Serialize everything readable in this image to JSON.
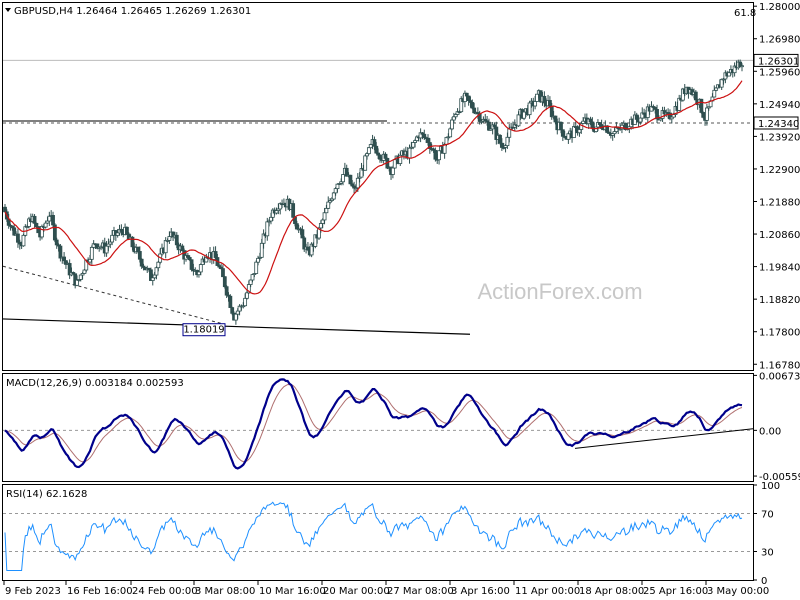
{
  "chart_data": [
    {
      "type": "candlestick",
      "panel": "price",
      "symbol_header": "GBPUSD,H4  1.26464 1.26465 1.26269 1.26301",
      "watermark": "ActionForex.com",
      "ylim": [
        1.166,
        1.281
      ],
      "y_ticks": [
        "1.28000",
        "1.26980",
        "1.25960",
        "1.24940",
        "1.23920",
        "1.22900",
        "1.21880",
        "1.20860",
        "1.19840",
        "1.18820",
        "1.17800",
        "1.16780"
      ],
      "current_price_label": "1.26301",
      "current_price": 1.26301,
      "level_label": "1.24340",
      "level": 1.2434,
      "low_label": "1.18019",
      "low_value": 1.18019,
      "fib_label": "61.8",
      "ma_color": "#cc1111",
      "candle_color": "#2f4f4f",
      "close_path": [
        1.217,
        1.21,
        1.206,
        1.214,
        1.208,
        1.215,
        1.204,
        1.198,
        1.193,
        1.2,
        1.206,
        1.204,
        1.208,
        1.21,
        1.205,
        1.2,
        1.195,
        1.201,
        1.209,
        1.205,
        1.2,
        1.196,
        1.203,
        1.201,
        1.193,
        1.183,
        1.187,
        1.195,
        1.205,
        1.215,
        1.219,
        1.218,
        1.21,
        1.202,
        1.208,
        1.216,
        1.224,
        1.228,
        1.222,
        1.23,
        1.237,
        1.233,
        1.229,
        1.233,
        1.234,
        1.24,
        1.238,
        1.232,
        1.238,
        1.247,
        1.251,
        1.248,
        1.244,
        1.242,
        1.236,
        1.241,
        1.246,
        1.248,
        1.252,
        1.249,
        1.243,
        1.239,
        1.241,
        1.244,
        1.242,
        1.243,
        1.24,
        1.242,
        1.244,
        1.245,
        1.248,
        1.246,
        1.245,
        1.249,
        1.255,
        1.252,
        1.245,
        1.252,
        1.258,
        1.26,
        1.263
      ]
    },
    {
      "type": "line",
      "panel": "macd",
      "title": "MACD(12,26,9) 0.003184 0.002593",
      "ylim": [
        -0.0062,
        0.0069
      ],
      "y_ticks": [
        "0.006731",
        "0.00",
        "-0.005595"
      ],
      "line_color": "#00008b",
      "signal_color": "#b07070",
      "trendline": true
    },
    {
      "type": "line",
      "panel": "rsi",
      "title": "RSI(14) 62.1628",
      "ylim": [
        0,
        100
      ],
      "y_ticks": [
        "100",
        "70",
        "30",
        "0"
      ],
      "levels": [
        70,
        30
      ],
      "line_color": "#1e90ff",
      "x_ticks": [
        "9 Feb 2023",
        "16 Feb 16:00",
        "24 Feb 00:00",
        "3 Mar 08:00",
        "10 Mar 16:00",
        "20 Mar 00:00",
        "27 Mar 08:00",
        "3 Apr 16:00",
        "11 Apr 00:00",
        "18 Apr 08:00",
        "25 Apr 16:00",
        "3 May 00:00"
      ]
    }
  ]
}
